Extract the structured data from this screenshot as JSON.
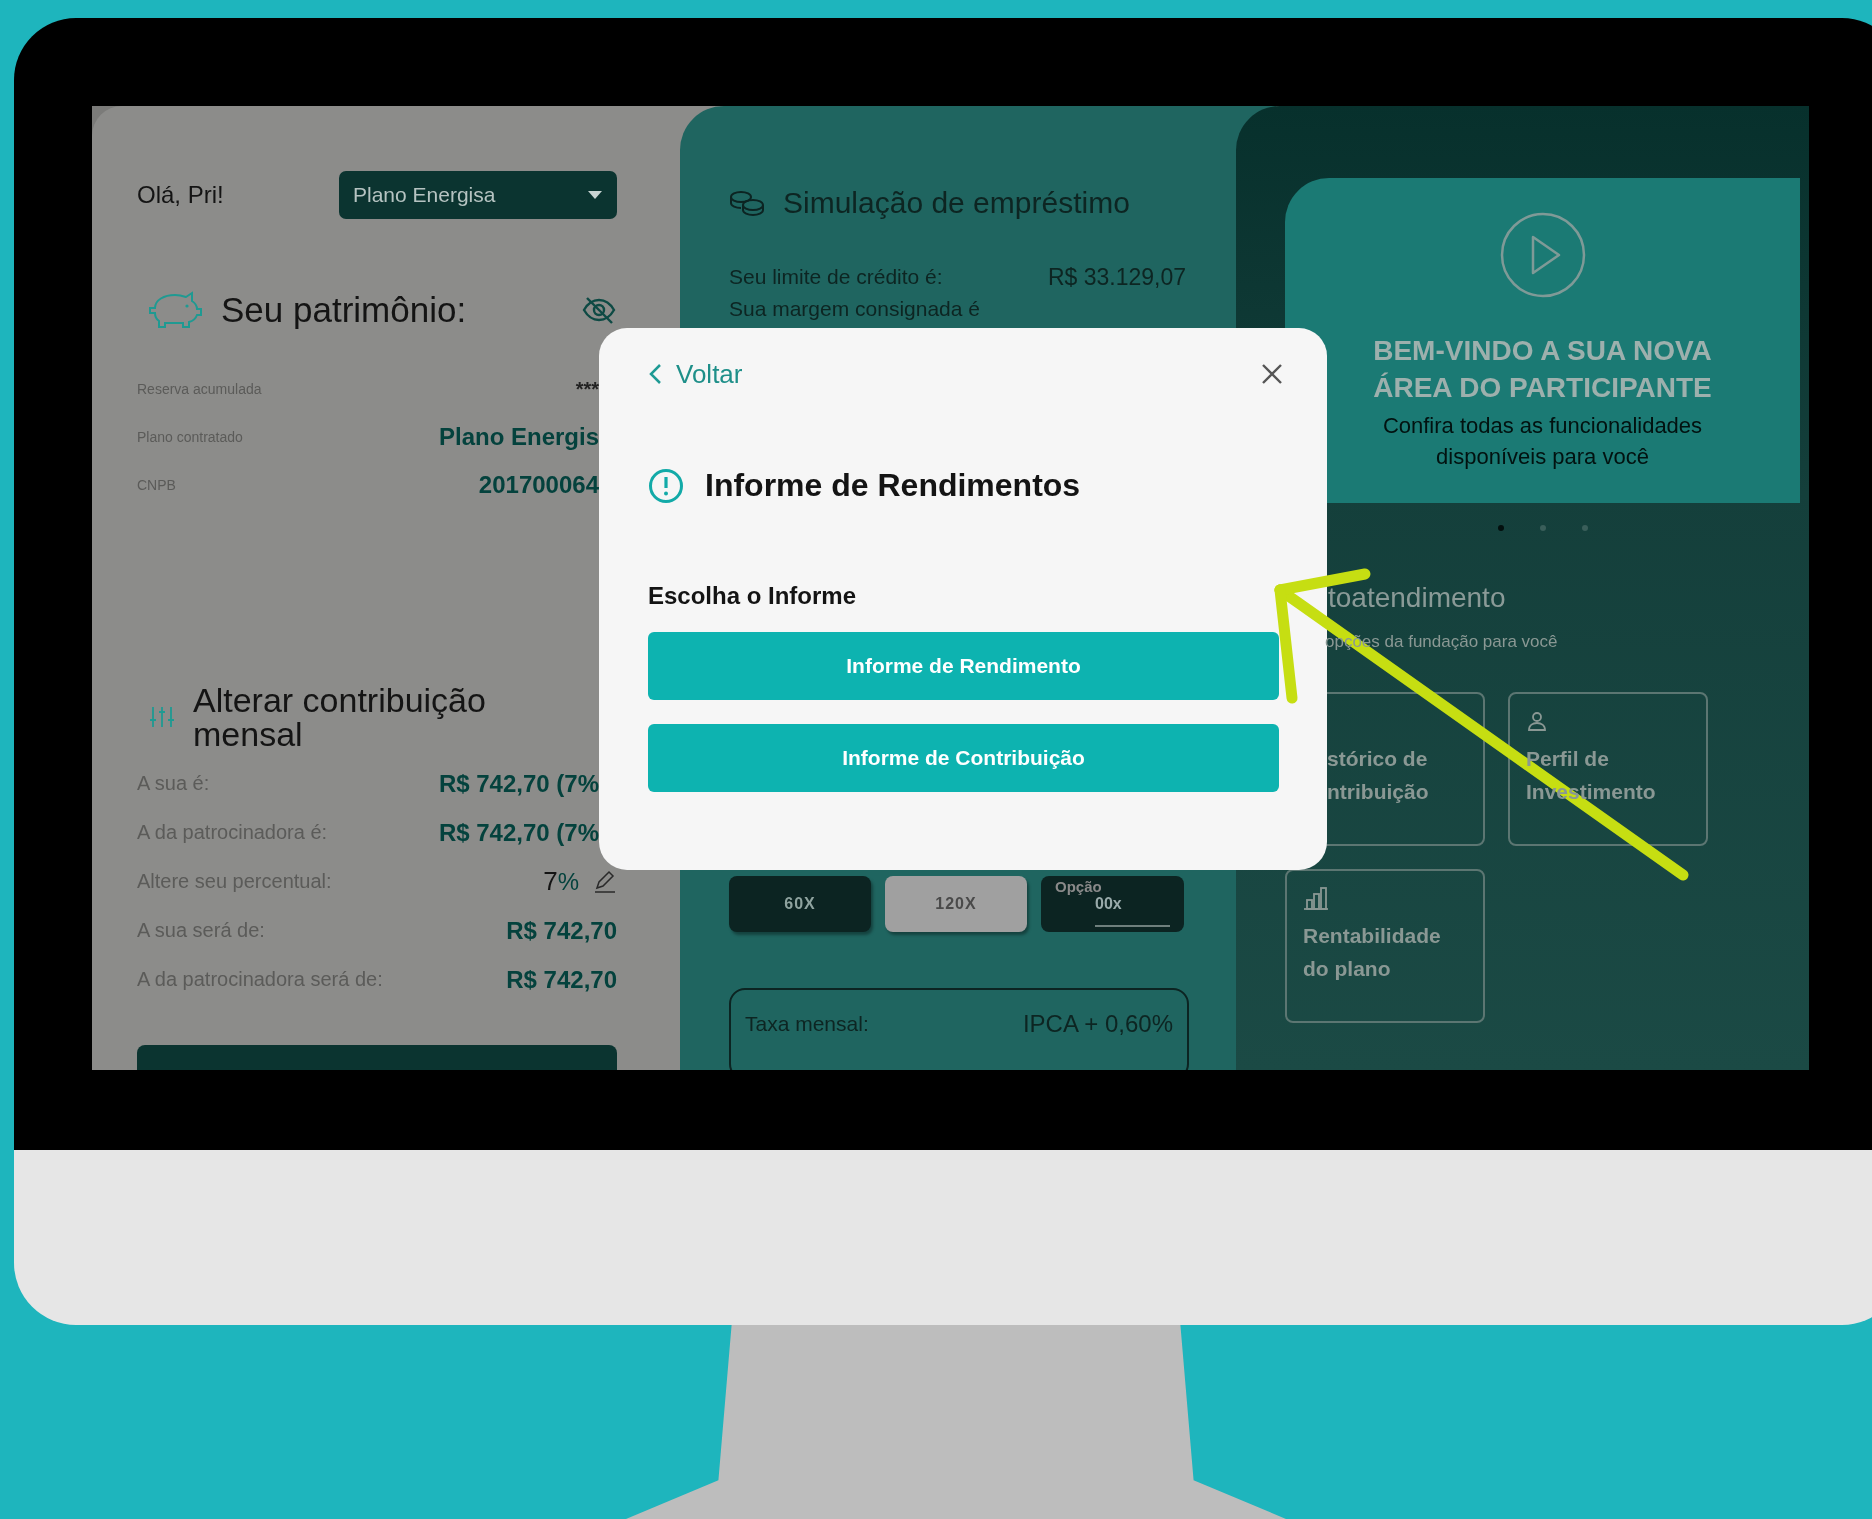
{
  "screen": {
    "account_panel": {
      "greeting": "Olá, Pri!",
      "plan_select": {
        "value": "Plano Energisa"
      },
      "patrimony": {
        "title": "Seu patrimônio:",
        "rows": [
          {
            "label": "Reserva acumulada",
            "value": "***",
            "kind": "masked"
          },
          {
            "label": "Plano contratado",
            "value": "Plano Energis",
            "kind": "highlight"
          },
          {
            "label": "CNPB",
            "value": "201700064",
            "kind": "highlight"
          }
        ]
      },
      "contribution": {
        "title": "Alterar contribuição mensal",
        "rows": [
          {
            "label": "A sua é:",
            "value": "R$ 742,70 (7%",
            "kind": "amount"
          },
          {
            "label": "A da patrocinadora é:",
            "value": "R$ 742,70 (7%",
            "kind": "amount"
          },
          {
            "label": "Altere seu percentual:",
            "value": "7",
            "unit": "%",
            "kind": "editable"
          },
          {
            "label": "A sua será de:",
            "value": "R$ 742,70",
            "kind": "amount"
          },
          {
            "label": "A da patrocinadora será de:",
            "value": "R$ 742,70",
            "kind": "amount"
          }
        ]
      }
    },
    "loan_panel": {
      "title": "Simulação de empréstimo",
      "rows": [
        {
          "label": "Seu limite de crédito é:",
          "value": "R$ 33.129,07"
        },
        {
          "label": "Sua margem consignada é"
        }
      ],
      "term_options": [
        {
          "label": "60X",
          "selected": true
        },
        {
          "label": "120X",
          "selected": false
        }
      ],
      "custom_term": {
        "label": "Opção",
        "value": "00x"
      },
      "rates": [
        {
          "label": "Taxa mensal:",
          "value": "IPCA + 0,60%"
        }
      ]
    },
    "home_panel": {
      "banner": {
        "title_lines": [
          "BEM-VINDO A SUA NOVA",
          "ÁREA DO PARTICIPANTE"
        ],
        "subtitle": "Confira todas as funcionalidades disponíveis para você"
      },
      "carousel_dots": [
        {
          "selected": true
        },
        {
          "selected": false
        },
        {
          "selected": false
        }
      ],
      "section": {
        "title": "toatendimento",
        "subtitle": "opções da fundação para você"
      },
      "cards": [
        {
          "label": "stórico de ntribuição",
          "kind": "plain"
        },
        {
          "label": "Perfil de Investimento",
          "kind": "profile"
        },
        {
          "label": "Rentabilidade do plano",
          "kind": "chart"
        }
      ]
    }
  },
  "modal": {
    "back": "Voltar",
    "title": "Informe de Rendimentos",
    "prompt": "Escolha o Informe",
    "buttons": [
      "Informe de Rendimento",
      "Informe de Contribuição"
    ]
  }
}
